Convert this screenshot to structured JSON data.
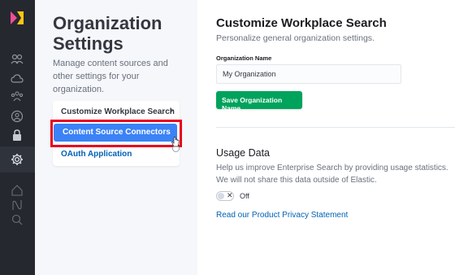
{
  "rail": {
    "icons": [
      "app-logo-icon",
      "users-icon",
      "cloud-icon",
      "groups-icon",
      "user-circle-icon",
      "lock-icon",
      "gear-icon",
      "home-icon",
      "sources-icon",
      "search-icon"
    ],
    "active": "gear-icon"
  },
  "panel": {
    "title": "Organization Settings",
    "description": "Manage content sources and other settings for your organization.",
    "nav": [
      {
        "label": "Customize Workplace Search",
        "chevron": "›"
      },
      {
        "label": "Content Source Connectors"
      },
      {
        "label": "OAuth Application"
      }
    ]
  },
  "main": {
    "title": "Customize Workplace Search",
    "subtitle": "Personalize general organization settings.",
    "org_name_label": "Organization Name",
    "org_name_value": "My Organization",
    "save_label": "Save Organization Name",
    "usage_title": "Usage Data",
    "usage_desc": "Help us improve Enterprise Search by providing usage statistics. We will not share this data outside of Elastic.",
    "toggle_state": "Off",
    "toggle_x": "✕",
    "privacy_link": "Read our Product Privacy Statement"
  },
  "colors": {
    "rail_bg": "#25282f",
    "panel_bg": "#f5f7fa",
    "active_nav": "#3b82f6",
    "save_button": "#00a35c",
    "link": "#0061b5",
    "highlight": "#e8001c"
  }
}
